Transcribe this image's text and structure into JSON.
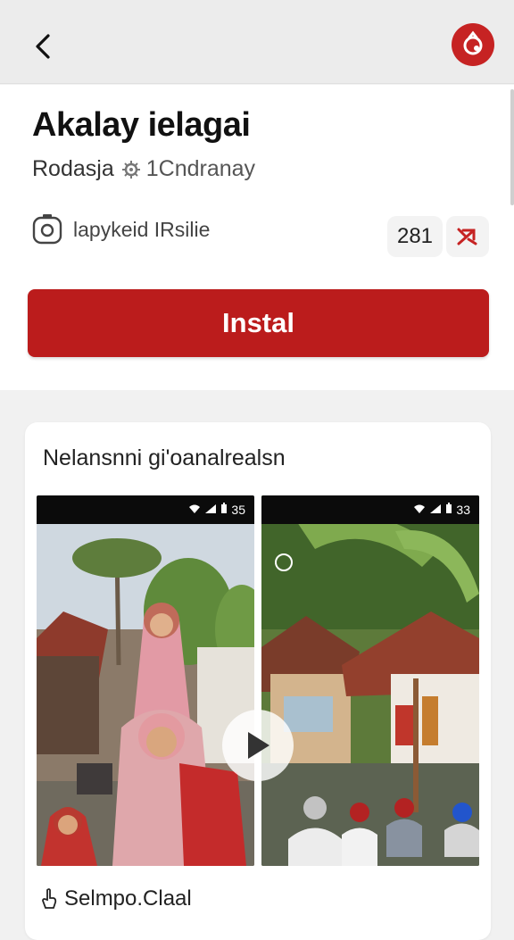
{
  "toolbar": {
    "back_icon": "arrow-back-icon",
    "brand_icon": "brand-logo-icon",
    "brand_color": "#c62323"
  },
  "app": {
    "title": "Akalay ielagai",
    "developer": "Rodasja",
    "category": "1Cndranay",
    "meta_label": "lapykeid IRsilie",
    "rating_count": "281",
    "accent_color": "#bb1c1c"
  },
  "install_label": "Instal",
  "preview": {
    "title": "Nelansnni gi'oanalrealsn",
    "shot1_time": "35",
    "shot2_time": "33",
    "footer_label": "Selmpo.Claal"
  }
}
